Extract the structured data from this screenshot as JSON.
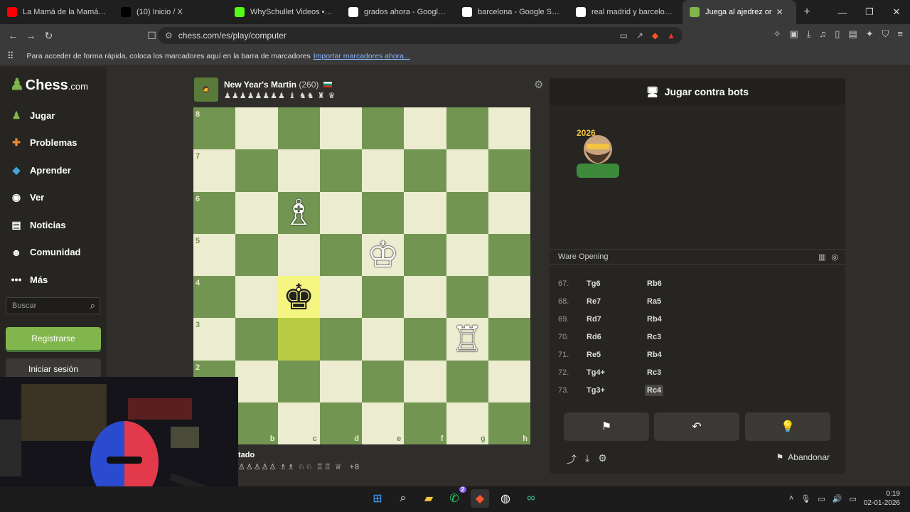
{
  "browser": {
    "tabs": [
      {
        "label": "La Mamá de la Mamá (Let",
        "color": "#ff0000"
      },
      {
        "label": "(10) Inicio / X",
        "color": "#000000"
      },
      {
        "label": "WhySchullet Videos • Wat",
        "color": "#53fc18"
      },
      {
        "label": "grados ahora - Google Se",
        "color": "#ffffff"
      },
      {
        "label": "barcelona - Google Search",
        "color": "#ffffff"
      },
      {
        "label": "real madrid y barcelona -",
        "color": "#ffffff"
      },
      {
        "label": "Juega al ajedrez or",
        "color": "#81b64c",
        "active": true
      }
    ],
    "url": "chess.com/es/play/computer",
    "bookmarks_text": "Para acceder de forma rápida, coloca los marcadores aquí en la barra de marcadores",
    "bookmarks_link": "Importar marcadores ahora..."
  },
  "sidebar": {
    "logo": "Chess",
    "logo_suffix": ".com",
    "items": [
      {
        "label": "Jugar",
        "icon": "pawn-icon",
        "color": "#81b64c"
      },
      {
        "label": "Problemas",
        "icon": "puzzle-icon",
        "color": "#f3872f"
      },
      {
        "label": "Aprender",
        "icon": "learn-icon",
        "color": "#43a4d9"
      },
      {
        "label": "Ver",
        "icon": "binoculars-icon",
        "color": "#ffffff"
      },
      {
        "label": "Noticias",
        "icon": "news-icon",
        "color": "#ffffff"
      },
      {
        "label": "Comunidad",
        "icon": "community-icon",
        "color": "#ffffff"
      },
      {
        "label": "Más",
        "icon": "more-icon",
        "color": "#ffffff"
      }
    ],
    "search_placeholder": "Buscar",
    "register_label": "Registrarse",
    "login_label": "Iniciar sesión"
  },
  "game": {
    "opponent_name": "New Year's Martin",
    "opponent_rating": "(260)",
    "opponent_captured": "♟♟♟♟♟♟♟♟ ♝ ♞♞ ♜ ♛",
    "player_name_partial": "tado",
    "player_captured": "♙♙♙♙♙ ♗♗ ♘♘ ♖♖ ♕",
    "player_advantage": "+8",
    "ranks": [
      "8",
      "7",
      "6",
      "5",
      "4",
      "3",
      "2"
    ],
    "files": [
      "b",
      "c",
      "d",
      "e",
      "f",
      "g",
      "h"
    ],
    "pieces": [
      {
        "square": "c6",
        "glyph": "♗",
        "side": "w"
      },
      {
        "square": "e5",
        "glyph": "♔",
        "side": "w"
      },
      {
        "square": "c4",
        "glyph": "♚",
        "side": "b"
      },
      {
        "square": "g3",
        "glyph": "♖",
        "side": "w"
      }
    ],
    "highlights": [
      "c4",
      "c3"
    ]
  },
  "panel": {
    "title": "Jugar contra bots",
    "bot_badge": "2026",
    "opening": "Ware Opening",
    "moves": [
      {
        "no": "67.",
        "white": "Tg6",
        "black": "Rb6"
      },
      {
        "no": "68.",
        "white": "Re7",
        "black": "Ra5"
      },
      {
        "no": "69.",
        "white": "Rd7",
        "black": "Rb4"
      },
      {
        "no": "70.",
        "white": "Rd6",
        "black": "Rc3"
      },
      {
        "no": "71.",
        "white": "Re5",
        "black": "Rb4"
      },
      {
        "no": "72.",
        "white": "Tg4+",
        "black": "Rc3"
      },
      {
        "no": "73.",
        "white": "Tg3+",
        "black": "Rc4",
        "current": true
      }
    ],
    "abandon_label": "Abandonar"
  },
  "taskbar": {
    "time": "0:19",
    "date": "02-01-2026",
    "whatsapp_badge": "2"
  }
}
